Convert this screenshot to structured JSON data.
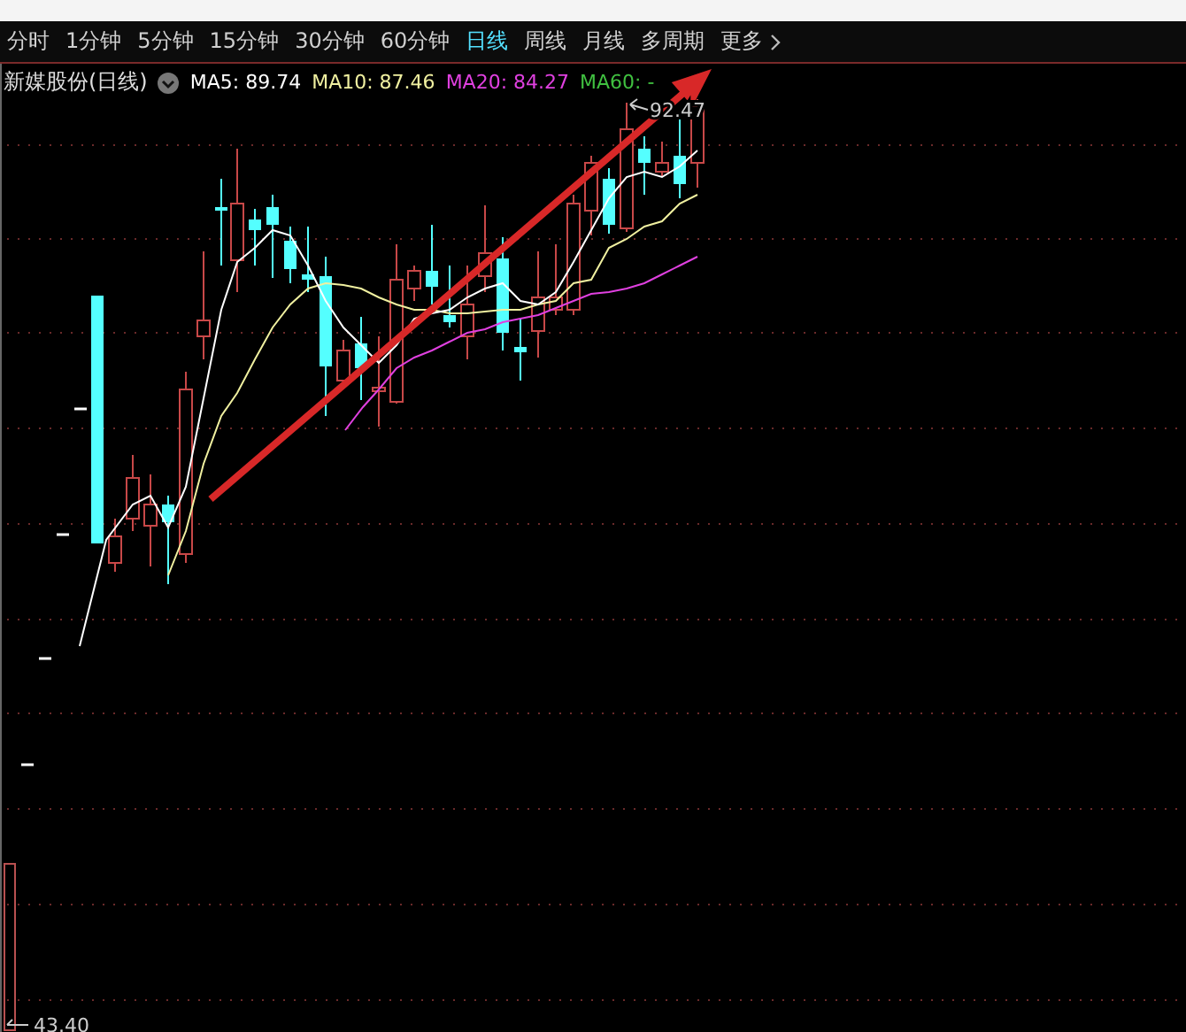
{
  "periods": [
    {
      "label": "分时",
      "selected": false
    },
    {
      "label": "1分钟",
      "selected": false
    },
    {
      "label": "5分钟",
      "selected": false
    },
    {
      "label": "15分钟",
      "selected": false
    },
    {
      "label": "30分钟",
      "selected": false
    },
    {
      "label": "60分钟",
      "selected": false
    },
    {
      "label": "日线",
      "selected": true
    },
    {
      "label": "周线",
      "selected": false
    },
    {
      "label": "月线",
      "selected": false
    },
    {
      "label": "多周期",
      "selected": false
    },
    {
      "label": "更多",
      "selected": false,
      "kind": "menu"
    }
  ],
  "legend": {
    "title": "新媒股份(日线)",
    "indicators": [
      {
        "label": "MA5: 89.74",
        "color": "#ffffff"
      },
      {
        "label": "MA10: 87.46",
        "color": "#f0f0a0"
      },
      {
        "label": "MA20: 84.27",
        "color": "#e040e0"
      },
      {
        "label": "MA60: -",
        "color": "#40c040"
      }
    ]
  },
  "chart": {
    "high_label": "92.47",
    "low_label": "43.40"
  }
}
